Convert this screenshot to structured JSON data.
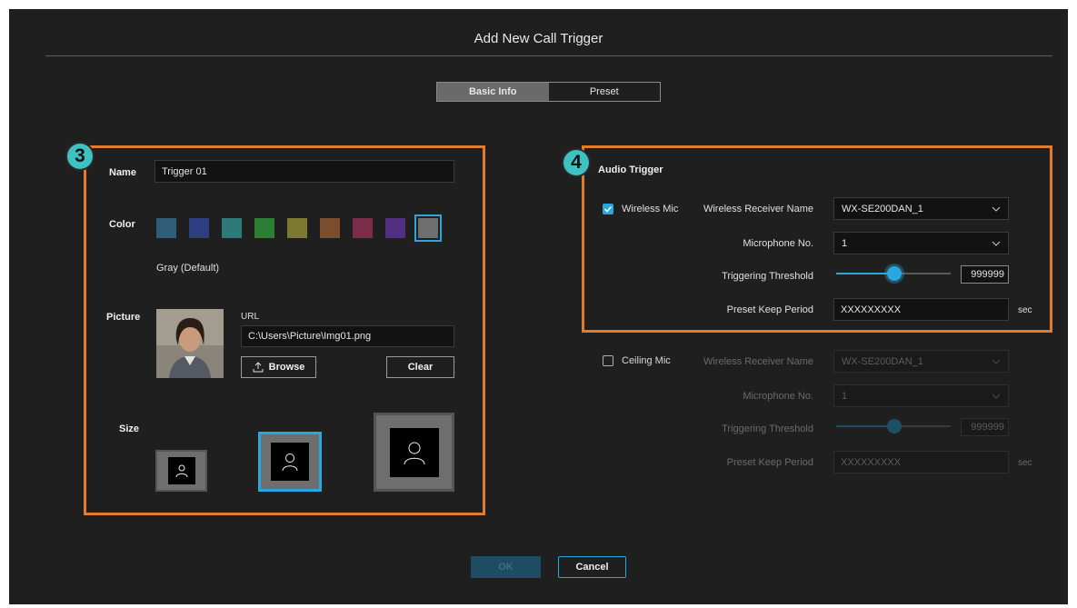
{
  "dialog": {
    "title": "Add New Call Trigger"
  },
  "tabs": [
    {
      "label": "Basic Info",
      "active": true
    },
    {
      "label": "Preset",
      "active": false
    }
  ],
  "section3": {
    "badge": "3",
    "name_label": "Name",
    "name_value": "Trigger 01",
    "color_label": "Color",
    "colors": [
      "#2f5d78",
      "#2d3f80",
      "#2e7a78",
      "#2e7d35",
      "#7c7a2e",
      "#7a4d2e",
      "#7a2e4a",
      "#502e80",
      "#6e6e6e"
    ],
    "selected_color_index": 8,
    "color_name": "Gray (Default)",
    "picture_label": "Picture",
    "url_label": "URL",
    "url_value": "C:\\Users\\Picture\\Img01.png",
    "browse_label": "Browse",
    "clear_label": "Clear",
    "size_label": "Size",
    "selected_size": "medium"
  },
  "section4": {
    "badge": "4",
    "heading": "Audio Trigger",
    "wireless": {
      "checked": true,
      "label": "Wireless Mic",
      "receiver_label": "Wireless Receiver Name",
      "receiver_value": "WX-SE200DAN_1",
      "mic_label": "Microphone No.",
      "mic_value": "1",
      "threshold_label": "Triggering Threshold",
      "threshold_value": "999999",
      "keep_label": "Preset Keep Period",
      "keep_value": "XXXXXXXXX",
      "keep_unit": "sec"
    },
    "ceiling": {
      "checked": false,
      "label": "Ceiling Mic",
      "receiver_label": "Wireless Receiver Name",
      "receiver_value": "WX-SE200DAN_1",
      "mic_label": "Microphone No.",
      "mic_value": "1",
      "threshold_label": "Triggering Threshold",
      "threshold_value": "999999",
      "keep_label": "Preset Keep Period",
      "keep_value": "XXXXXXXXX",
      "keep_unit": "sec"
    }
  },
  "footer": {
    "ok_label": "OK",
    "cancel_label": "Cancel"
  },
  "accent_color": "#29a8e0",
  "highlight_color": "#e37b2c"
}
